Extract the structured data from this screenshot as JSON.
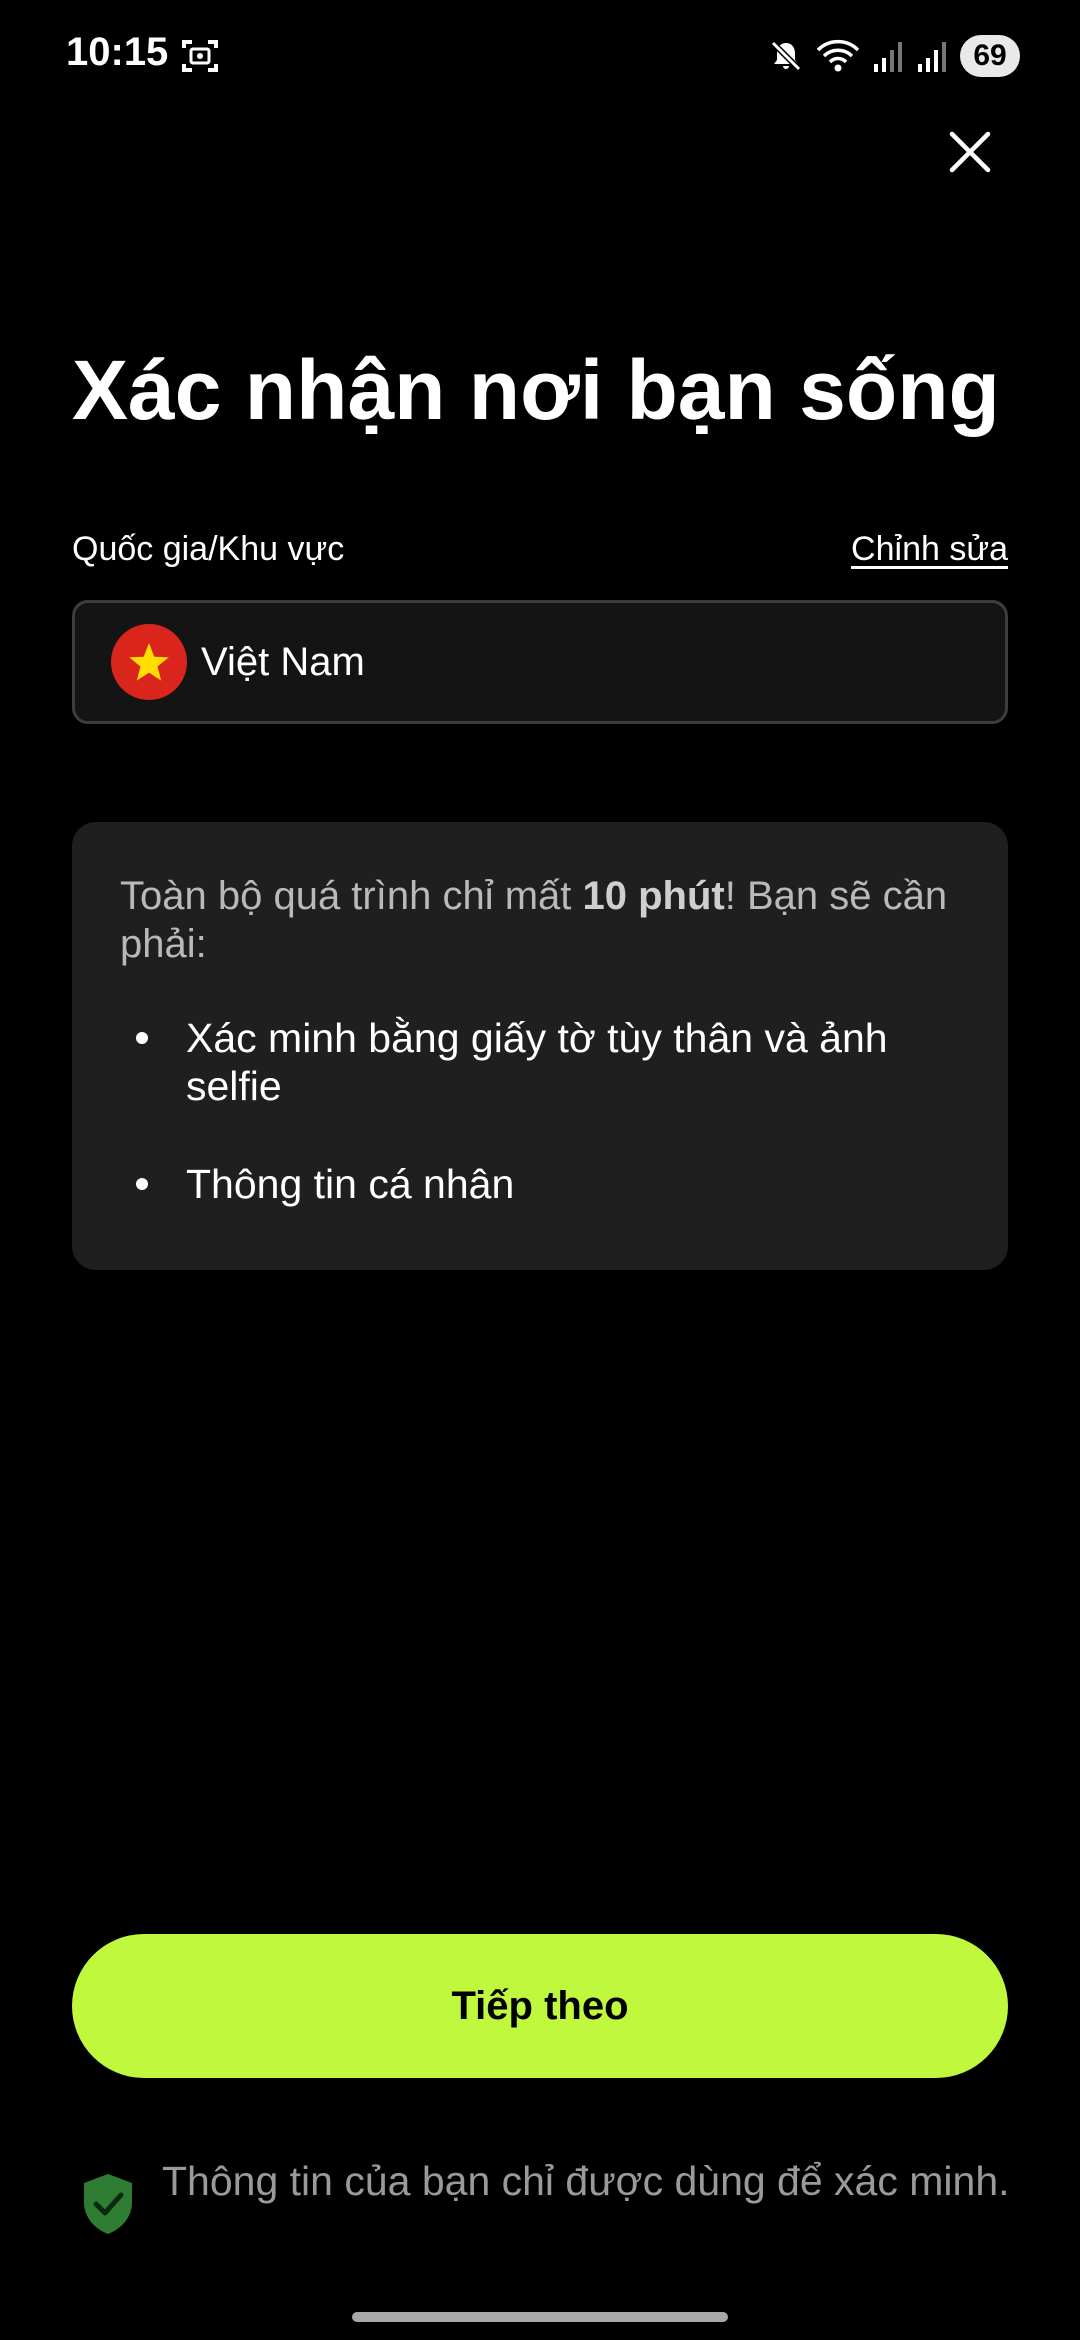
{
  "status_bar": {
    "time": "10:15",
    "battery": "69",
    "icons": [
      "screenshot-icon",
      "mute-icon",
      "wifi-icon",
      "signal-icon",
      "signal-icon"
    ]
  },
  "header": {
    "close_icon": "close-icon"
  },
  "title": "Xác nhận nơi bạn sống",
  "country": {
    "label": "Quốc gia/Khu vực",
    "edit_label": "Chỉnh sửa",
    "value": "Việt Nam",
    "flag_icon": "vietnam-flag-icon"
  },
  "info": {
    "intro_before": "Toàn bộ quá trình chỉ mất ",
    "intro_bold": "10 phút",
    "intro_after": "! Bạn sẽ cần phải:",
    "items": [
      {
        "label": "Xác minh bằng giấy tờ tùy thân và ảnh selfie"
      },
      {
        "label": "Thông tin cá nhân"
      }
    ]
  },
  "next_button": {
    "label": "Tiếp theo",
    "color": "#bff83d"
  },
  "privacy": {
    "text": "Thông tin của bạn chỉ được dùng để xác minh.",
    "icon": "shield-check-icon",
    "icon_color": "#2e7d32"
  }
}
